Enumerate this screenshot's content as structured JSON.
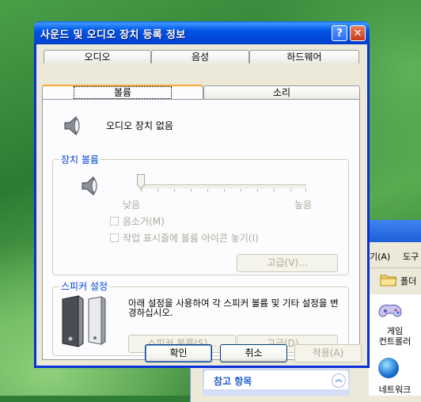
{
  "dialog": {
    "title": "사운드 및 오디오 장치 등록 정보",
    "help_glyph": "?",
    "close_glyph": "✕"
  },
  "tabs_back": [
    {
      "label": "오디오"
    },
    {
      "label": "음성"
    },
    {
      "label": "하드웨어"
    }
  ],
  "tabs_front": [
    {
      "label": "볼륨",
      "active": true
    },
    {
      "label": "소리",
      "active": false
    }
  ],
  "device": {
    "name": "오디오 장치 없음"
  },
  "device_volume": {
    "group_title": "장치 볼륨",
    "low_label": "낮음",
    "high_label": "높음",
    "level": 0,
    "mute_label": "음소거(M)",
    "mute_checked": false,
    "tray_icon_label": "작업 표시줄에 볼륨 아이콘 놓기(I)",
    "tray_icon_checked": false,
    "advanced_label": "고급(V)..."
  },
  "speaker_settings": {
    "group_title": "스피커 설정",
    "description": "아래 설정을 사용하여 각 스피커 볼륨 및 기타 설정을 변경하십시오.",
    "speaker_volume_label": "스피커 볼륨(S)...",
    "advanced_label": "고급(D)..."
  },
  "footer": {
    "ok_label": "확인",
    "cancel_label": "취소",
    "apply_label": "적용(A)"
  },
  "background_window": {
    "menu_items": [
      "기(A)",
      "도구"
    ],
    "toolbar_folder_label": "폴더",
    "game_controller_label": "게임\n컨트롤러",
    "network_label": "네트워크",
    "panel_title": "참고 항목",
    "panel_chevron": "︽"
  },
  "colors": {
    "titlebar": "#0055e5",
    "group_title": "#0046d5",
    "disabled_text": "#aca899",
    "dialog_face": "#ece9d8"
  }
}
